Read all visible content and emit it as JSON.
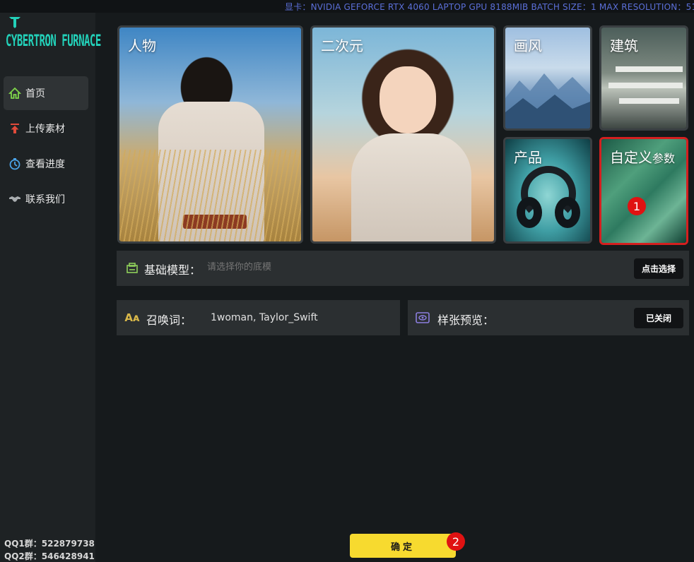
{
  "status_bar": {
    "text": "显卡：NVIDIA GEFORCE RTX 4060 LAPTOP GPU 8188MIB  BATCH SIZE：1  MAX RESOLUTION：512,5"
  },
  "sidebar": {
    "logo_text": "CYBERTRON FURNACE",
    "items": [
      {
        "label": "首页",
        "icon": "home-icon",
        "active": true
      },
      {
        "label": "上传素材",
        "icon": "upload-icon",
        "active": false
      },
      {
        "label": "查看进度",
        "icon": "timer-icon",
        "active": false
      },
      {
        "label": "联系我们",
        "icon": "handshake-icon",
        "active": false
      }
    ],
    "qq1": "QQ1群：522879738",
    "qq2": "QQ2群：546428941"
  },
  "categories": {
    "person": "人物",
    "anime": "二次元",
    "style": "画风",
    "architecture": "建筑",
    "product": "产品",
    "custom_main": "自定义",
    "custom_sub": "参数"
  },
  "annotations": {
    "badge1": "1",
    "badge2": "2"
  },
  "base_model": {
    "label": "基础模型：",
    "placeholder": "请选择你的底模",
    "button": "点击选择"
  },
  "prompt": {
    "label": "召唤词：",
    "value": "1woman, Taylor_Swift"
  },
  "preview": {
    "label": "样张预览：",
    "button": "已关闭"
  },
  "confirm_label": "确定",
  "colors": {
    "accent_yellow": "#f7da2f",
    "highlight_red": "#d41f1f",
    "logo_teal": "#23d1b9",
    "status_blue": "#5b6fd8"
  }
}
